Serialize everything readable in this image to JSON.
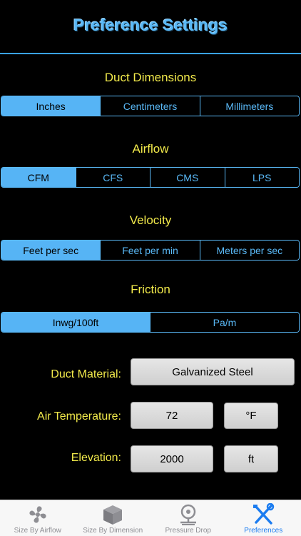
{
  "title": "Preference Settings",
  "duct_dimensions": {
    "label": "Duct Dimensions",
    "options": [
      "Inches",
      "Centimeters",
      "Millimeters"
    ],
    "selected": "Inches"
  },
  "airflow": {
    "label": "Airflow",
    "options": [
      "CFM",
      "CFS",
      "CMS",
      "LPS"
    ],
    "selected": "CFM"
  },
  "velocity": {
    "label": "Velocity",
    "options": [
      "Feet per sec",
      "Feet per min",
      "Meters per sec"
    ],
    "selected": "Feet per sec"
  },
  "friction": {
    "label": "Friction",
    "options": [
      "Inwg/100ft",
      "Pa/m"
    ],
    "selected": "Inwg/100ft"
  },
  "settings": {
    "duct_material_label": "Duct Material:",
    "duct_material_value": "Galvanized Steel",
    "air_temperature_label": "Air Temperature:",
    "air_temperature_value": "72",
    "air_temperature_unit": "°F",
    "elevation_label": "Elevation:",
    "elevation_value": "2000",
    "elevation_unit": "ft"
  },
  "tabbar": {
    "items": [
      {
        "label": "Size By Airflow",
        "icon": "fan-icon"
      },
      {
        "label": "Size By Dimension",
        "icon": "cube-icon"
      },
      {
        "label": "Pressure Drop",
        "icon": "gauge-icon"
      },
      {
        "label": "Preferences",
        "icon": "tools-icon"
      }
    ],
    "active_index": 3
  },
  "colors": {
    "accent": "#56b4f5",
    "label_yellow": "#f2ea4b",
    "tab_active": "#1b7cf0",
    "tab_inactive": "#8e8e93"
  }
}
